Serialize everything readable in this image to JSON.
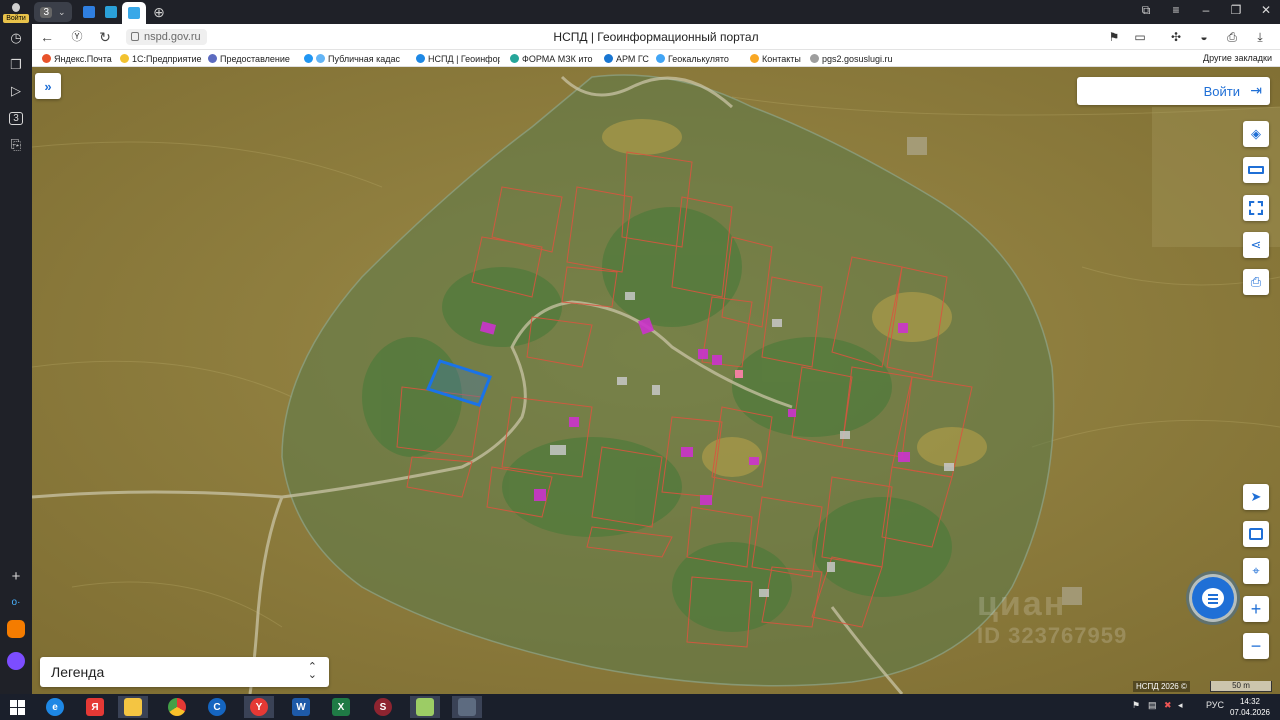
{
  "browser": {
    "profile_label": "Войти",
    "tab_count_badge": "3",
    "sidebar_badge": "3",
    "url": "nspd.gov.ru",
    "page_title": "НСПД | Геоинформационный портал"
  },
  "bookmarks": [
    {
      "label": "Яндекс.Почта",
      "color": "#e8532b"
    },
    {
      "label": "1С:Предприятие",
      "color": "#f2c230"
    },
    {
      "label": "Предоставление",
      "color": "#5c6bc0"
    },
    {
      "label": "Публичная кадас",
      "color": "#2196f3"
    },
    {
      "label": "НСПД | Геоинфор",
      "color": "#1e88e5"
    },
    {
      "label": "ФОРМА МЗК ито",
      "color": "#26a69a"
    },
    {
      "label": "АРМ ГС",
      "color": "#1976d2"
    },
    {
      "label": "Геокалькулято",
      "color": "#42a5f5"
    },
    {
      "label": "Контакты",
      "color": "#f9a825"
    },
    {
      "label": "pgs2.gosuslugi.ru",
      "color": "#9e9e9e"
    }
  ],
  "bookmarks_other": "Другие закладки",
  "map": {
    "login_label": "Войти",
    "legend_label": "Легенда",
    "copyright": "НСПД 2026 ©",
    "scale_label": "50 m",
    "watermark_line1": "циан",
    "watermark_line2": "ID 323767959"
  },
  "taskbar": {
    "language": "РУС",
    "time": "14:32",
    "date": "07.04.2026",
    "apps": [
      {
        "name": "internet-explorer",
        "color": "#1e88e5",
        "glyph": "e"
      },
      {
        "name": "yandex",
        "color": "#e53935",
        "glyph": "Я"
      },
      {
        "name": "explorer",
        "color": "#f4c542",
        "glyph": ""
      },
      {
        "name": "chrome",
        "color": "#43a047",
        "glyph": ""
      },
      {
        "name": "ccleaner",
        "color": "#1565c0",
        "glyph": "C"
      },
      {
        "name": "yandex-browser",
        "color": "#e53935",
        "glyph": "Y"
      },
      {
        "name": "word",
        "color": "#1e5aa8",
        "glyph": "W"
      },
      {
        "name": "excel",
        "color": "#1f7a45",
        "glyph": "X"
      },
      {
        "name": "app-s",
        "color": "#8e2430",
        "glyph": "S"
      },
      {
        "name": "sticky-notes",
        "color": "#9ccc65",
        "glyph": ""
      },
      {
        "name": "app-figure",
        "color": "#5d6b80",
        "glyph": ""
      }
    ]
  }
}
